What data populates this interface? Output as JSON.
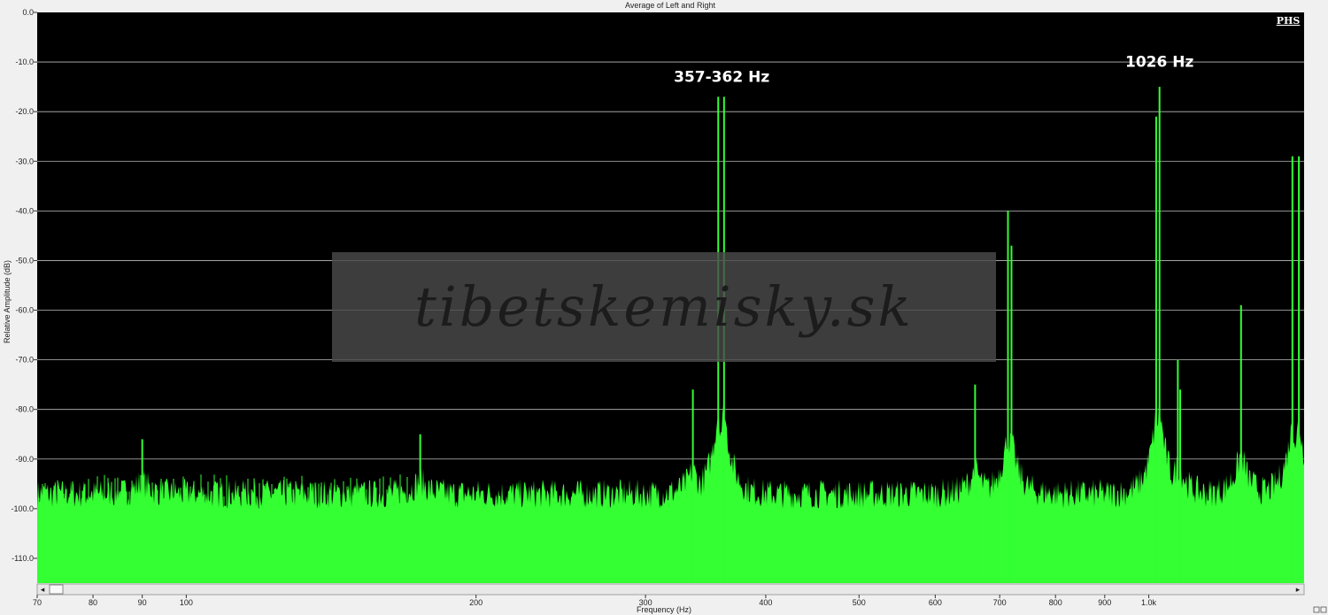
{
  "chart_data": {
    "type": "area",
    "title": "Average of Left and Right",
    "xlabel": "Frequency (Hz)",
    "ylabel": "Relative Amplitude (dB)",
    "x_scale": "log",
    "xlim": [
      70,
      1450
    ],
    "ylim": [
      -115,
      0
    ],
    "grid": true,
    "background_color": "#000000",
    "series_color": "#33ff33",
    "y_ticks": [
      0,
      -10,
      -20,
      -30,
      -40,
      -50,
      -60,
      -70,
      -80,
      -90,
      -100,
      -110
    ],
    "y_tick_labels": [
      "0.0",
      "-10.0",
      "-20.0",
      "-30.0",
      "-40.0",
      "-50.0",
      "-60.0",
      "-70.0",
      "-80.0",
      "-90.0",
      "-100.0",
      "-110.0"
    ],
    "x_ticks": [
      70,
      80,
      90,
      100,
      200,
      300,
      400,
      500,
      600,
      700,
      800,
      900,
      1000
    ],
    "x_tick_labels": [
      "70",
      "80",
      "90",
      "100",
      "200",
      "300",
      "400",
      "500",
      "600",
      "700",
      "800",
      "900",
      "1.0k"
    ],
    "noise_floor_db": -100,
    "peaks": [
      {
        "x": 90,
        "y": -86
      },
      {
        "x": 175,
        "y": -85
      },
      {
        "x": 336,
        "y": -76
      },
      {
        "x": 357,
        "y": -17
      },
      {
        "x": 362,
        "y": -17
      },
      {
        "x": 660,
        "y": -75
      },
      {
        "x": 714,
        "y": -40
      },
      {
        "x": 720,
        "y": -47
      },
      {
        "x": 1018,
        "y": -21
      },
      {
        "x": 1026,
        "y": -15
      },
      {
        "x": 1072,
        "y": -70
      },
      {
        "x": 1078,
        "y": -76
      },
      {
        "x": 1247,
        "y": -59
      },
      {
        "x": 1410,
        "y": -29
      },
      {
        "x": 1432,
        "y": -29
      }
    ],
    "annotations": [
      {
        "text": "357-362 Hz",
        "x": 360,
        "y": -14
      },
      {
        "text": "1026 Hz",
        "x": 1026,
        "y": -11
      }
    ]
  },
  "watermark": {
    "text": "tibetskemisky.sk"
  },
  "logo": {
    "text": "PHS"
  },
  "scrollbar": {
    "left_arrow": "◂",
    "right_arrow": "▸"
  }
}
